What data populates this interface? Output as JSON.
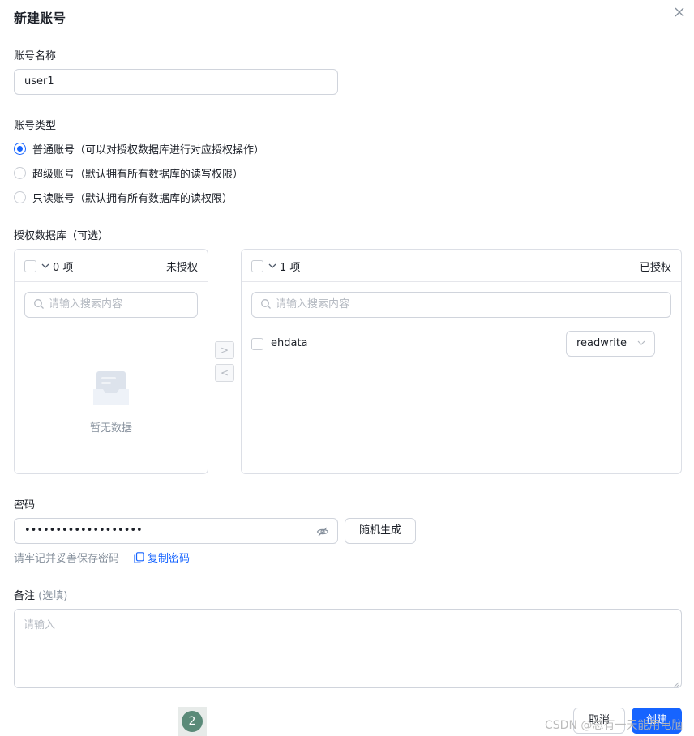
{
  "dialog": {
    "title": "新建账号"
  },
  "account_name": {
    "label": "账号名称",
    "value": "user1"
  },
  "account_type": {
    "label": "账号类型",
    "options": [
      {
        "label": "普通账号（可以对授权数据库进行对应授权操作）",
        "selected": true
      },
      {
        "label": "超级账号（默认拥有所有数据库的读写权限）",
        "selected": false
      },
      {
        "label": "只读账号（默认拥有所有数据库的读权限）",
        "selected": false
      }
    ]
  },
  "auth_db": {
    "label": "授权数据库（可选）",
    "left": {
      "count": "0 项",
      "title": "未授权",
      "search_placeholder": "请输入搜索内容",
      "empty_text": "暂无数据"
    },
    "right": {
      "count": "1 项",
      "title": "已授权",
      "search_placeholder": "请输入搜索内容",
      "items": [
        {
          "name": "ehdata",
          "permission": "readwrite"
        }
      ]
    },
    "move_right": ">",
    "move_left": "<"
  },
  "password": {
    "label": "密码",
    "value": "•••••••••••••••••••",
    "generate_label": "随机生成",
    "hint": "请牢记并妥善保存密码",
    "copy_label": "复制密码"
  },
  "remark": {
    "label": "备注",
    "optional": "(选填)",
    "placeholder": "请输入"
  },
  "footer": {
    "badge": "2",
    "cancel_label": "取消",
    "create_label": "创建"
  },
  "watermark": "CSDN @总有一天能用电脑",
  "colors": {
    "primary": "#1664ff",
    "border": "#d0d4dc",
    "text": "#1d2129",
    "muted": "#86909c"
  },
  "icons": {
    "close": "close-icon",
    "search": "search-icon",
    "eye_off": "eye-off-icon",
    "copy": "copy-icon",
    "chevron_down": "chevron-down-icon",
    "empty": "empty-box-icon"
  }
}
